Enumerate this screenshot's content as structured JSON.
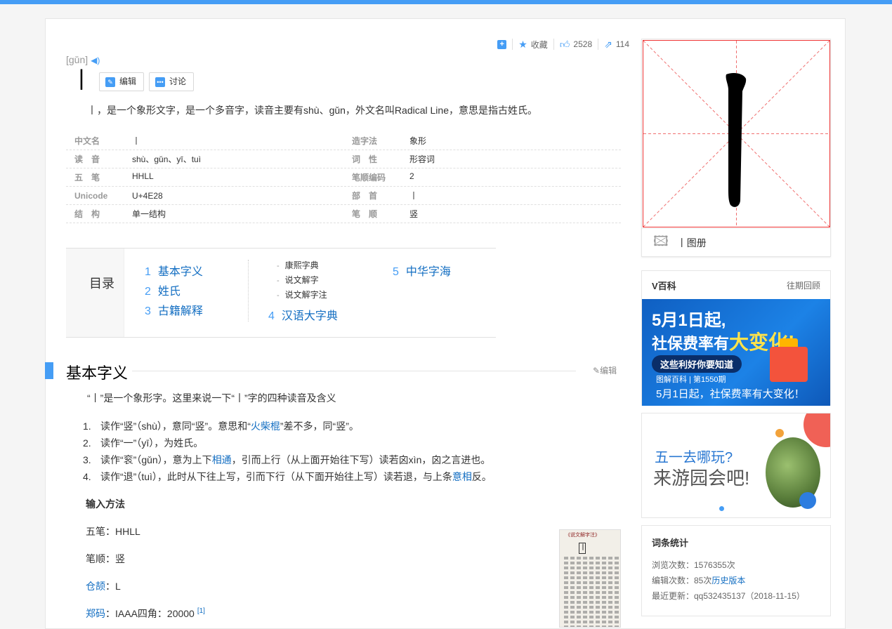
{
  "header": {
    "pinyin": "[gǔn]",
    "char": "丨",
    "edit_label": "编辑",
    "discuss_label": "讨论"
  },
  "tools": {
    "favorite": "收藏",
    "likes": "2528",
    "shares": "114"
  },
  "summary": "丨，是一个象形文字，是一个多音字，读音主要有shù、gǔn，外文名叫Radical Line，意思是指古姓氏。",
  "info_left": [
    {
      "k": "中文名",
      "v": "丨"
    },
    {
      "k": "读　音",
      "v": "shù、gǔn、yī、tuì"
    },
    {
      "k": "五　笔",
      "v": "HHLL"
    },
    {
      "k": "Unicode",
      "v": "U+4E28"
    },
    {
      "k": "结　构",
      "v": "单一结构"
    }
  ],
  "info_right": [
    {
      "k": "造字法",
      "v": "象形"
    },
    {
      "k": "词　性",
      "v": "形容词"
    },
    {
      "k": "笔顺编码",
      "v": "2"
    },
    {
      "k": "部　首",
      "v": "丨"
    },
    {
      "k": "笔　顺",
      "v": "竖"
    }
  ],
  "catalog": {
    "title": "目录",
    "items": [
      {
        "num": "1",
        "label": "基本字义"
      },
      {
        "num": "2",
        "label": "姓氏"
      },
      {
        "num": "3",
        "label": "古籍解释"
      },
      {
        "num": "4",
        "label": "汉语大字典"
      },
      {
        "num": "5",
        "label": "中华字海"
      }
    ],
    "subs": [
      "康熙字典",
      "说文解字",
      "说文解字注"
    ]
  },
  "section": {
    "title": "基本字义",
    "edit": "编辑",
    "intro": "“丨”是一个象形字。这里来说一下“丨”字的四种读音及含义",
    "list": [
      {
        "n": "1.",
        "parts": [
          "读作“竖”（shù），意同“竖”。意思和“",
          "火柴棍",
          "”差不多，同“竖”。"
        ]
      },
      {
        "n": "2.",
        "parts": [
          "读作“一”（yī），为姓氏。",
          "",
          ""
        ]
      },
      {
        "n": "3.",
        "parts": [
          "读作“衮”（gǔn），意为上下",
          "相通",
          "，引而上行（从上面开始往下写）读若囟xìn，囟之言进也。"
        ]
      },
      {
        "n": "4.",
        "parts": [
          "读作“退”（tuì），此时从下往上写，引而下行（从下面开始往上写）读若退，与上条",
          "意相",
          "反。"
        ]
      }
    ],
    "input_title": "输入方法",
    "wubi": "五笔：HHLL",
    "bishun": "笔顺：竖",
    "cangjie_link": "仓颉",
    "cangjie_val": "：L",
    "zhengma_link": "郑码",
    "zhengma_val": "：IAAA四角：20000",
    "ref": "[1]",
    "book_title": "《说文解字注》",
    "book_char": "丨"
  },
  "right": {
    "gallery": "丨图册",
    "vbaike_title": "V百科",
    "vbaike_more": "往期回顾",
    "banner_line1": "5月1日起,",
    "banner_line2a": "社保费率有",
    "banner_line2b": "大变化!",
    "banner_pill": "这些利好你要知道",
    "banner_meta": "图解百科 | 第1550期",
    "banner_caption": "5月1日起，社保费率有大变化！",
    "ad_line1": "五一去哪玩?",
    "ad_line2": "来游园会吧!",
    "stats_title": "词条统计",
    "views": "浏览次数：1576355次",
    "edits_prefix": "编辑次数：85次",
    "edits_link": "历史版本",
    "updated": "最近更新：qq532435137（2018-11-15）"
  }
}
